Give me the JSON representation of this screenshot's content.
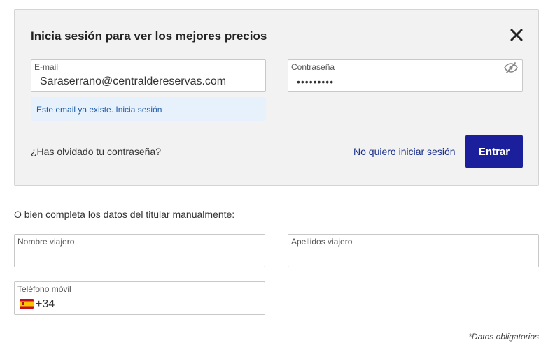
{
  "login": {
    "title": "Inicia sesión para ver los mejores precios",
    "email_label": "E-mail",
    "email_value": "Saraserrano@centraldereservas.com",
    "password_label": "Contraseña",
    "password_value": "•••••••••",
    "notice": "Este email ya existe. Inicia sesión",
    "forgot_password": "¿Has olvidado tu contraseña?",
    "skip_login": "No quiero iniciar sesión",
    "submit": "Entrar"
  },
  "manual": {
    "intro": "O bien completa los datos del titular manualmente:",
    "first_name_label": "Nombre viajero",
    "last_name_label": "Apellidos viajero",
    "phone_label": "Teléfono móvil",
    "phone_prefix": "+34",
    "required_note": "*Datos obligatorios"
  },
  "icons": {
    "close": "close-icon",
    "password_toggle": "eye-slash-icon",
    "flag": "spain-flag-icon"
  },
  "colors": {
    "accent": "#1c1f9c",
    "link": "#1a2f8a",
    "notice_bg": "#e6f1fb",
    "notice_text": "#1e5aa8",
    "panel_bg": "#f2f2f2"
  }
}
